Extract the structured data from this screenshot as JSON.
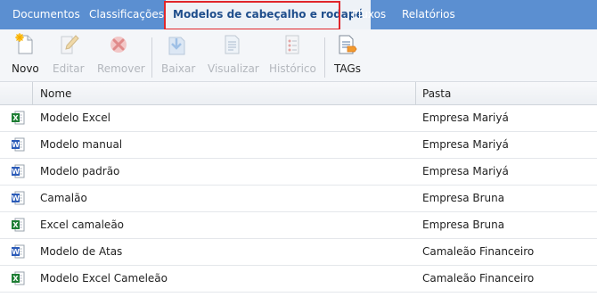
{
  "tabs": [
    {
      "label": "Documentos",
      "active": false
    },
    {
      "label": "Classificações",
      "active": false
    },
    {
      "label": "Modelos de cabeçalho e rodapé",
      "active": true
    },
    {
      "label": "Fluxos",
      "active": false
    },
    {
      "label": "Relatórios",
      "active": false
    }
  ],
  "toolbar": {
    "novo": {
      "label": "Novo",
      "enabled": true,
      "icon": "new-document-icon"
    },
    "editar": {
      "label": "Editar",
      "enabled": false,
      "icon": "pencil-icon"
    },
    "remover": {
      "label": "Remover",
      "enabled": false,
      "icon": "remove-x-icon"
    },
    "baixar": {
      "label": "Baixar",
      "enabled": false,
      "icon": "download-icon"
    },
    "visualizar": {
      "label": "Visualizar",
      "enabled": false,
      "icon": "view-document-icon"
    },
    "historico": {
      "label": "Histórico",
      "enabled": false,
      "icon": "history-list-icon"
    },
    "tags": {
      "label": "TAGs",
      "enabled": true,
      "icon": "tags-document-icon"
    }
  },
  "table": {
    "columns": [
      "Nome",
      "Pasta"
    ],
    "rows": [
      {
        "name": "Modelo Excel",
        "folder": "Empresa Mariyá",
        "type": "excel"
      },
      {
        "name": "Modelo manual",
        "folder": "Empresa Mariyá",
        "type": "word"
      },
      {
        "name": "Modelo padrão",
        "folder": "Empresa Mariyá",
        "type": "word"
      },
      {
        "name": "Camalão",
        "folder": "Empresa Bruna",
        "type": "word"
      },
      {
        "name": "Excel camaleão",
        "folder": "Empresa Bruna",
        "type": "excel"
      },
      {
        "name": "Modelo de Atas",
        "folder": "Camaleão Financeiro",
        "type": "word"
      },
      {
        "name": "Modelo Excel Cameleão",
        "folder": "Camaleão Financeiro",
        "type": "excel"
      }
    ]
  },
  "colors": {
    "tabbar": "#5b8fd1",
    "active_tab_text": "#1f4e8c",
    "focus_outline": "#e0262b",
    "excel_icon": "#1e7e34",
    "word_icon": "#2b5bb8"
  }
}
